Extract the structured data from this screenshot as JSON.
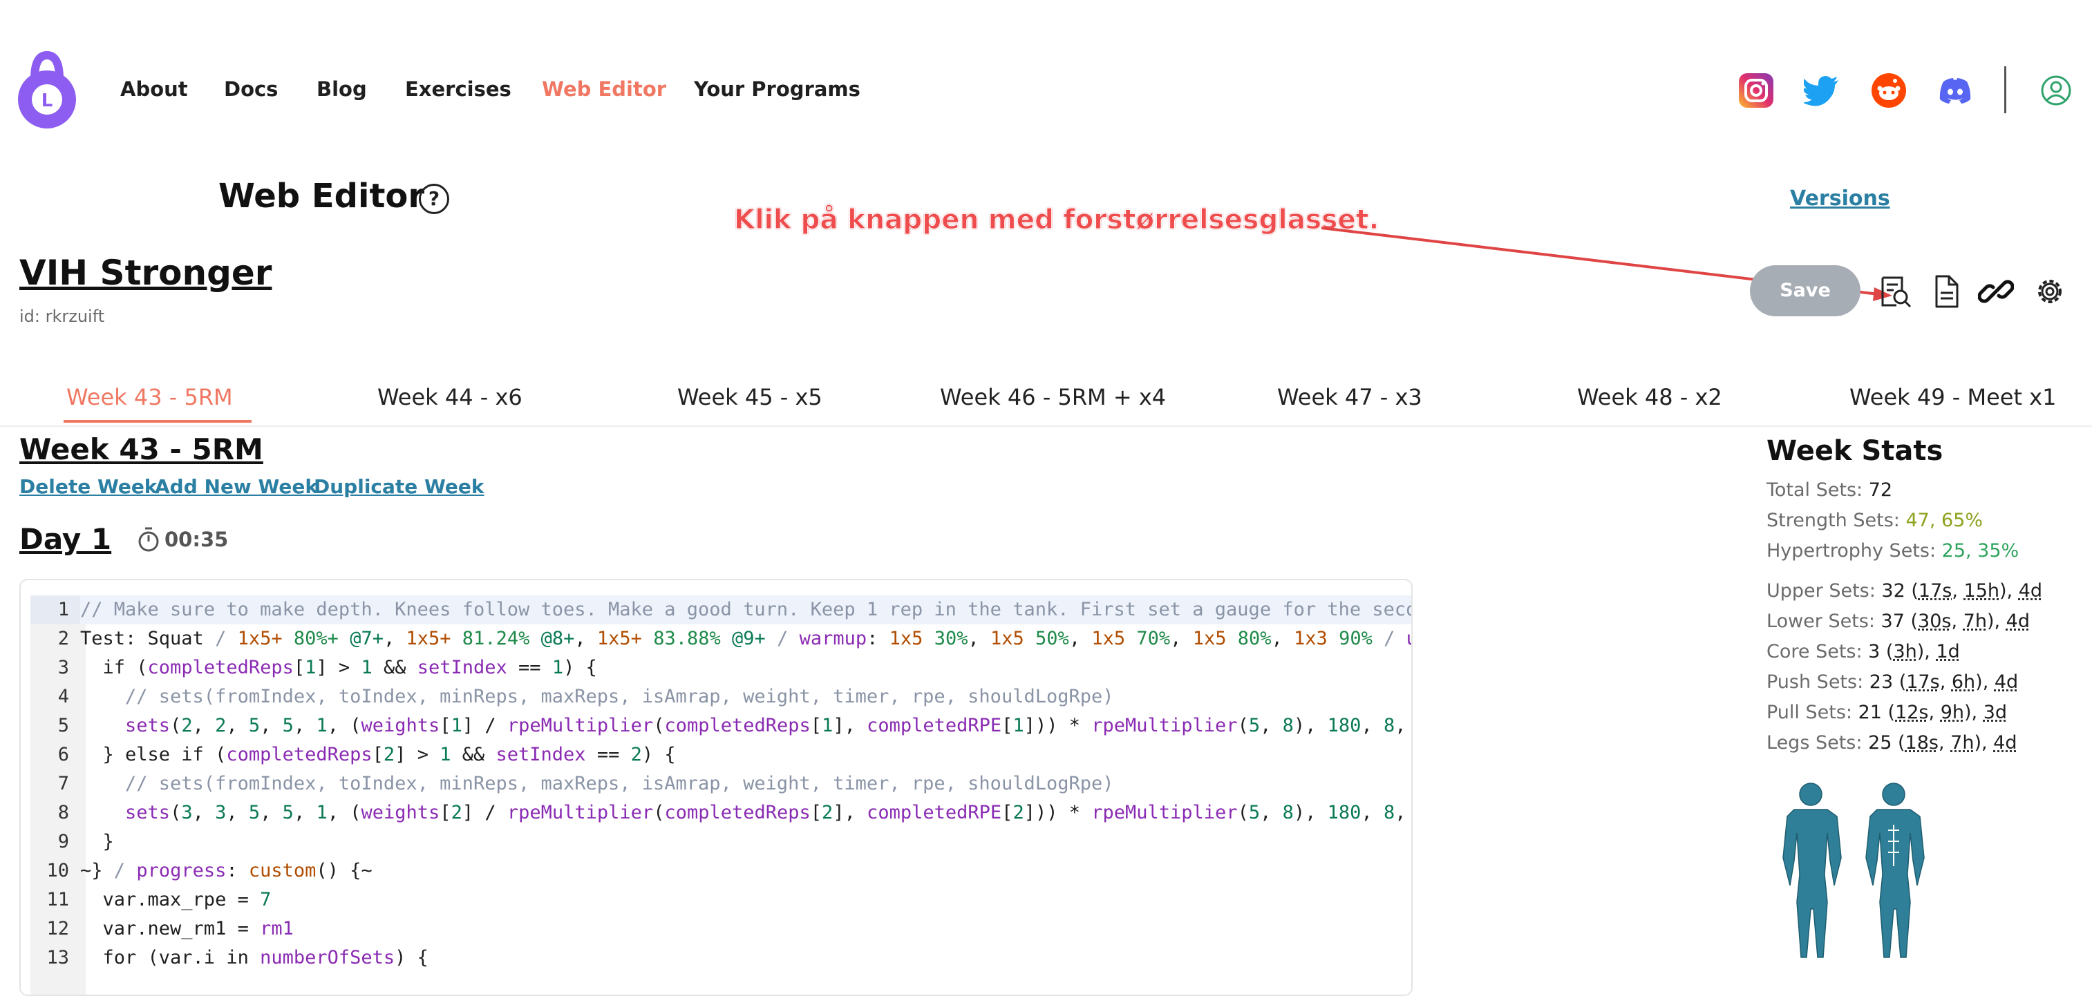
{
  "nav": {
    "items": [
      "About",
      "Docs",
      "Blog",
      "Exercises",
      "Web Editor",
      "Your Programs"
    ],
    "active": "Web Editor"
  },
  "logo": {
    "letter": "L",
    "color": "#8d5cf0"
  },
  "social": [
    "instagram-icon",
    "twitter-icon",
    "reddit-icon",
    "discord-icon"
  ],
  "header": {
    "title": "Web Editor",
    "help": "?",
    "versions": "Versions"
  },
  "annotation": {
    "text": "Klik på knappen med forstørrelsesglasset.",
    "color": "#ef4d4d"
  },
  "program": {
    "name": "VIH Stronger",
    "id": "id: rkrzuift"
  },
  "toolbar": {
    "save": "Save",
    "icons": [
      "preview-magnifier-icon",
      "document-icon",
      "link-icon",
      "settings-icon"
    ]
  },
  "tabs": [
    "Week 43 - 5RM",
    "Week 44 - x6",
    "Week 45 - x5",
    "Week 46 - 5RM + x4",
    "Week 47 - x3",
    "Week 48 - x2",
    "Week 49 - Meet x1"
  ],
  "week": {
    "title": "Week 43 - 5RM",
    "links": [
      "Delete Week",
      "Add New Week",
      "Duplicate Week"
    ]
  },
  "day": {
    "title": "Day 1",
    "time": "00:35"
  },
  "editor": {
    "line_numbers": [
      "1",
      "2",
      "3",
      "4",
      "5",
      "6",
      "7",
      "8",
      "9",
      "10",
      "11",
      "12",
      "13"
    ]
  },
  "stats": {
    "title": "Week Stats",
    "total": {
      "label": "Total Sets: ",
      "value": "72"
    },
    "strength": {
      "label": "Strength Sets: ",
      "value": "47, 65%"
    },
    "hypertrophy": {
      "label": "Hypertrophy Sets: ",
      "value": "25, 35%"
    },
    "rows": [
      {
        "label": "Upper Sets: ",
        "a": "32",
        "b": "17s",
        "c": "15h",
        "d": "4d"
      },
      {
        "label": "Lower Sets: ",
        "a": "37",
        "b": "30s",
        "c": "7h",
        "d": "4d"
      },
      {
        "label": "Core Sets: ",
        "a": "3",
        "b": "3h",
        "c": "",
        "d": "1d"
      },
      {
        "label": "Push Sets: ",
        "a": "23",
        "b": "17s",
        "c": "6h",
        "d": "4d"
      },
      {
        "label": "Pull Sets: ",
        "a": "21",
        "b": "12s",
        "c": "9h",
        "d": "3d"
      },
      {
        "label": "Legs Sets: ",
        "a": "25",
        "b": "18s",
        "c": "7h",
        "d": "4d"
      }
    ]
  },
  "colors": {
    "accent": "#f07863",
    "link": "#2a7fa3",
    "muscle": "#2e7f97"
  }
}
